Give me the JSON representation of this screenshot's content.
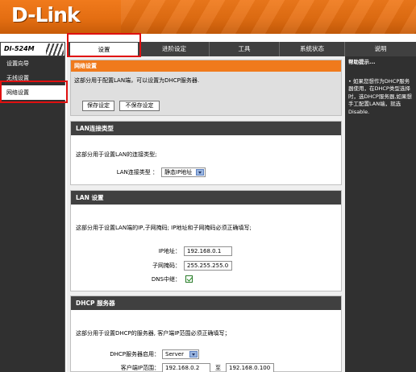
{
  "brand": {
    "logo": "D-Link",
    "model": "DI-524M"
  },
  "nav": {
    "tabs": [
      {
        "label": "设置"
      },
      {
        "label": "进阶设定"
      },
      {
        "label": "工具"
      },
      {
        "label": "系统状态"
      },
      {
        "label": "说明"
      }
    ]
  },
  "sidebar": {
    "items": [
      {
        "label": "设置向导"
      },
      {
        "label": "无线设置"
      },
      {
        "label": "网络设置"
      }
    ]
  },
  "intro": {
    "title": "网络设置",
    "text": "这部分用于配置LAN端，可以设置为DHCP服务器.",
    "save_label": "保存设定",
    "nosave_label": "不保存设定"
  },
  "lan_type": {
    "header": "LAN连接类型",
    "desc": "这部分用于设置LAN的连接类型;",
    "label": "LAN连接类型 ：",
    "value": "静态IP地址"
  },
  "lan_settings": {
    "header": "LAN 设置",
    "desc": "这部分用于设置LAN端的IP,子网掩码; IP地址和子网掩码必须正确填写;",
    "ip_label": "IP地址：",
    "ip_value": "192.168.0.1",
    "mask_label": "子网掩码：",
    "mask_value": "255.255.255.0",
    "dns_label": "DNS中继："
  },
  "dhcp": {
    "header": "DHCP 服务器",
    "desc": "这部分用于设置DHCP的服务器, 客户端IP范围必须正确填写；",
    "enable_label": "DHCP服务器启用：",
    "enable_value": "Server",
    "range_label": "客户端IP范围：",
    "range_start": "192.168.0.2",
    "range_to": "至",
    "range_end": "192.168.0.100"
  },
  "help": {
    "title": "帮助提示...",
    "text": "• 如果您想作为DHCP服务器使用，在DHCP类型选择时，选DHCP服务器,如果想手工配置LAN端，就选Disable."
  },
  "colors": {
    "accent": "#f07a1c",
    "nav_bg": "#404040",
    "highlight": "#e01010"
  }
}
